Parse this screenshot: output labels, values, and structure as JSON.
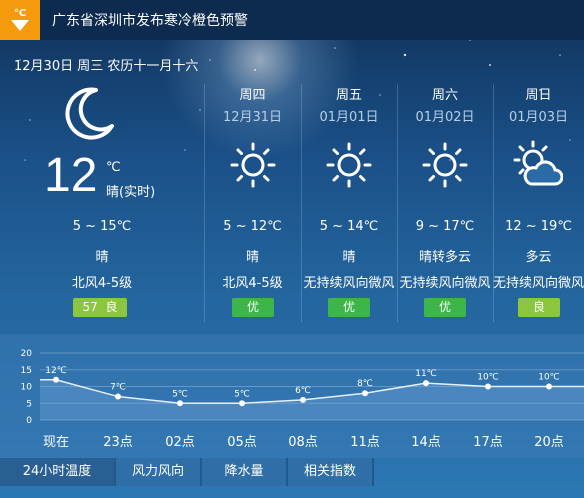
{
  "warning": {
    "icon": "cold-warning-icon",
    "icon_label": "°C",
    "title": "广东省深圳市发布寒冷橙色预警",
    "color": "#f59a0c"
  },
  "today": {
    "date_line": "12月30日 周三 农历十一月十六",
    "icon": "moon-icon",
    "temp": "12",
    "unit": "℃",
    "condition_now": "晴(实时)",
    "range": "5 ~ 15℃",
    "weather": "晴",
    "wind": "北风4-5级",
    "aqi_value": "57",
    "aqi_label": "良",
    "aqi_color": "#8cc63e"
  },
  "forecast": [
    {
      "day": "周四",
      "date": "12月31日",
      "icon": "sun-icon",
      "range": "5 ~ 12℃",
      "weather": "晴",
      "wind": "北风4-5级",
      "aqi": "优",
      "aqi_color": "#3cb64a"
    },
    {
      "day": "周五",
      "date": "01月01日",
      "icon": "sun-icon",
      "range": "5 ~ 14℃",
      "weather": "晴",
      "wind": "无持续风向微风",
      "aqi": "优",
      "aqi_color": "#3cb64a"
    },
    {
      "day": "周六",
      "date": "01月02日",
      "icon": "sun-icon",
      "range": "9 ~ 17℃",
      "weather": "晴转多云",
      "wind": "无持续风向微风",
      "aqi": "优",
      "aqi_color": "#3cb64a"
    },
    {
      "day": "周日",
      "date": "01月03日",
      "icon": "partly-cloudy-icon",
      "range": "12 ~ 19℃",
      "weather": "多云",
      "wind": "无持续风向微风",
      "aqi": "良",
      "aqi_color": "#8cc63e"
    }
  ],
  "chart_data": {
    "type": "line",
    "categories": [
      "现在",
      "23点",
      "02点",
      "05点",
      "08点",
      "11点",
      "14点",
      "17点",
      "20点"
    ],
    "values": [
      12,
      7,
      5,
      5,
      6,
      8,
      11,
      10,
      10
    ],
    "point_labels": [
      "12℃",
      "7℃",
      "5℃",
      "5℃",
      "6℃",
      "8℃",
      "11℃",
      "10℃",
      "10℃"
    ],
    "yticks": [
      "20",
      "15",
      "10",
      "5",
      "0"
    ],
    "ylim": [
      0,
      20
    ]
  },
  "tabs": [
    {
      "label": "24小时温度",
      "active": true
    },
    {
      "label": "风力风向",
      "active": false
    },
    {
      "label": "降水量",
      "active": false
    },
    {
      "label": "相关指数",
      "active": false
    }
  ]
}
